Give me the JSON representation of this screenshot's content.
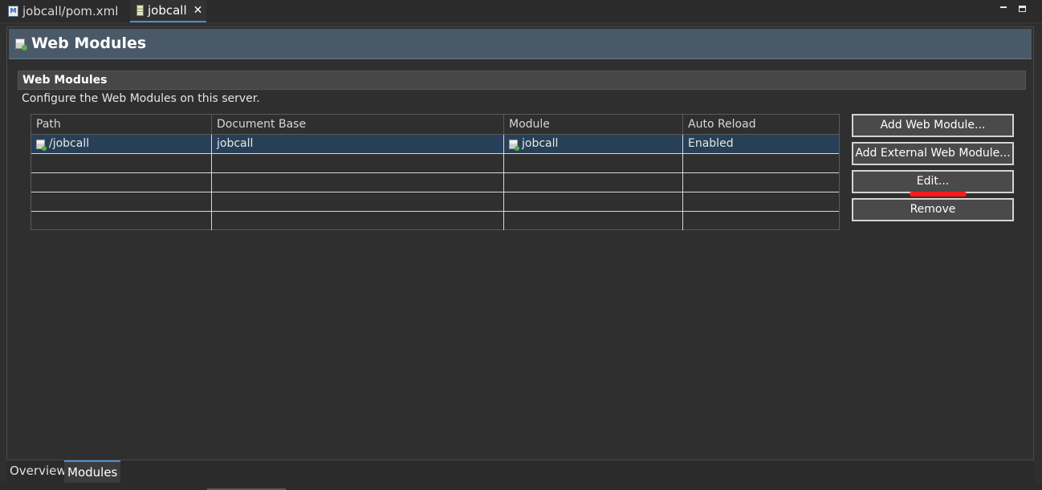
{
  "editor_tabs": [
    {
      "label": "jobcall/pom.xml",
      "icon": "maven-pom-icon",
      "active": false
    },
    {
      "label": "jobcall",
      "icon": "server-icon",
      "active": true,
      "close": "✕"
    }
  ],
  "header": {
    "title": "Web Modules",
    "icon": "web-module-icon"
  },
  "section": {
    "title": "Web Modules",
    "description": "Configure the Web Modules on this server."
  },
  "table": {
    "columns": [
      "Path",
      "Document Base",
      "Module",
      "Auto Reload"
    ],
    "rows": [
      {
        "path": "/jobcall",
        "document_base": "jobcall",
        "module": "jobcall",
        "auto_reload": "Enabled",
        "selected": true
      }
    ]
  },
  "buttons": {
    "add": "Add Web Module...",
    "add_external": "Add External Web Module...",
    "edit": "Edit...",
    "remove": "Remove"
  },
  "bottom_tabs": [
    {
      "label": "Overview",
      "active": false
    },
    {
      "label": "Modules",
      "active": true
    }
  ],
  "colors": {
    "header_bg": "#4a5968",
    "selection": "#274057",
    "accent": "#4a8fd6",
    "annotation": "#ff1a1a"
  }
}
